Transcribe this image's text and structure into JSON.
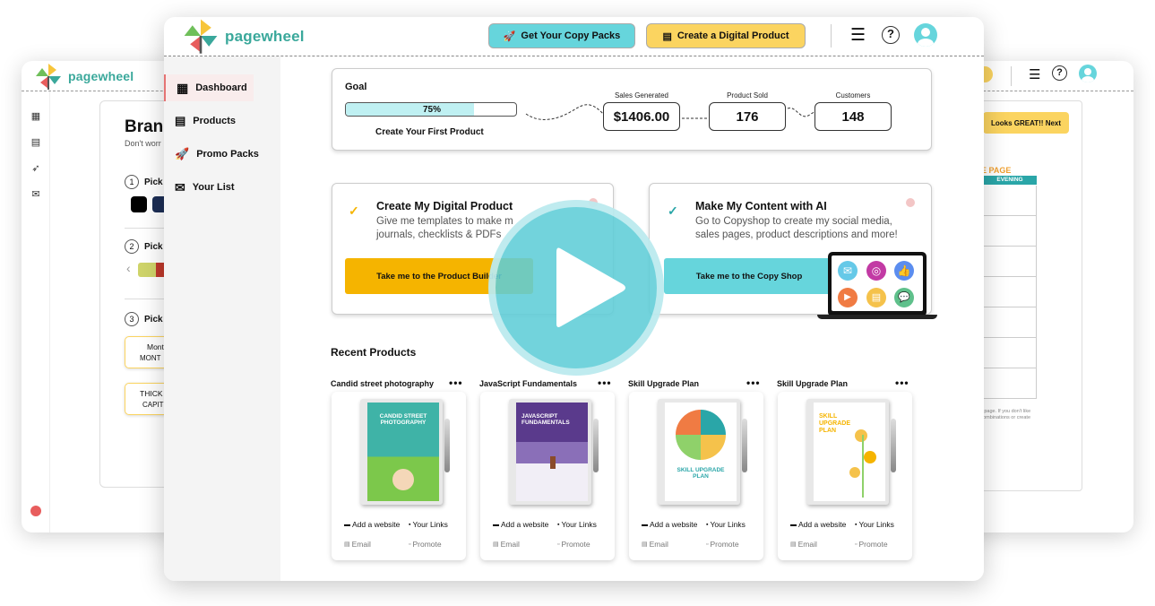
{
  "brand": {
    "logo_text": "pagewheel"
  },
  "back_window": {
    "sidebar_icons": [
      "dashboard-icon",
      "products-icon",
      "rocket-icon",
      "mail-icon"
    ],
    "panel": {
      "title": "Brand",
      "subtitle": "Don't worr",
      "steps": [
        {
          "num": "1",
          "label": "Pick"
        },
        {
          "num": "2",
          "label": "Pick"
        },
        {
          "num": "3",
          "label": "Pick"
        }
      ],
      "font_options": [
        {
          "line1": "Mont",
          "line2": "MONT"
        },
        {
          "line1": "THICK",
          "line2": "CAPIT"
        }
      ]
    },
    "right_panel": {
      "button_label": "Looks GREAT!! Next",
      "section_title": "E PAGE",
      "column_label": "EVENING",
      "note_line1": "ns page. If you don't like",
      "note_line2": "r combinations or create"
    }
  },
  "header": {
    "copy_packs_label": "Get Your Copy Packs",
    "digital_product_label": "Create a Digital Product"
  },
  "sidebar": {
    "items": [
      {
        "label": "Dashboard",
        "icon": "dashboard-icon"
      },
      {
        "label": "Products",
        "icon": "products-icon"
      },
      {
        "label": "Promo Packs",
        "icon": "rocket-icon"
      },
      {
        "label": "Your List",
        "icon": "mail-icon"
      }
    ]
  },
  "goal": {
    "title": "Goal",
    "progress_label": "75%",
    "progress_fraction": 0.75,
    "caption": "Create Your First Product",
    "stats": [
      {
        "label": "Sales Generated",
        "value": "$1406.00"
      },
      {
        "label": "Product Sold",
        "value": "176"
      },
      {
        "label": "Customers",
        "value": "148"
      }
    ]
  },
  "action_cards": [
    {
      "title": "Create My Digital Product",
      "desc_line1": "Give me templates to make m",
      "desc_line2": "journals, checklists & PDFs",
      "button_label": "Take me to the Product Builder",
      "check_color": "#f5b400",
      "button_color": "#f5b400"
    },
    {
      "title": "Make My Content with AI",
      "desc_line1": "Go to Copyshop to create my social media,",
      "desc_line2": "sales pages, product descriptions and more!",
      "button_label": "Take me to the Copy Shop",
      "check_color": "#2aa6a8",
      "button_color": "#66d5dc"
    }
  ],
  "recent": {
    "title": "Recent Products",
    "more_label": "•••",
    "add_website_label": "Add a website",
    "your_links_label": "Your Links",
    "email_label": "Email",
    "promote_label": "Promote",
    "products": [
      {
        "name": "Candid street photography",
        "cover_title": "CANDID STREET PHOTOGRAPHY"
      },
      {
        "name": "JavaScript Fundamentals",
        "cover_title": "JAVASCRIPT FUNDAMENTALS"
      },
      {
        "name": "Skill Upgrade Plan",
        "cover_title": "SKILL UPGRADE PLAN"
      },
      {
        "name": "Skill Upgrade Plan",
        "cover_title": "SKILL UPGRADE PLAN"
      }
    ]
  },
  "colors": {
    "teal": "#66d5dc",
    "yellow": "#fbd460",
    "accent_red": "#e57373"
  }
}
